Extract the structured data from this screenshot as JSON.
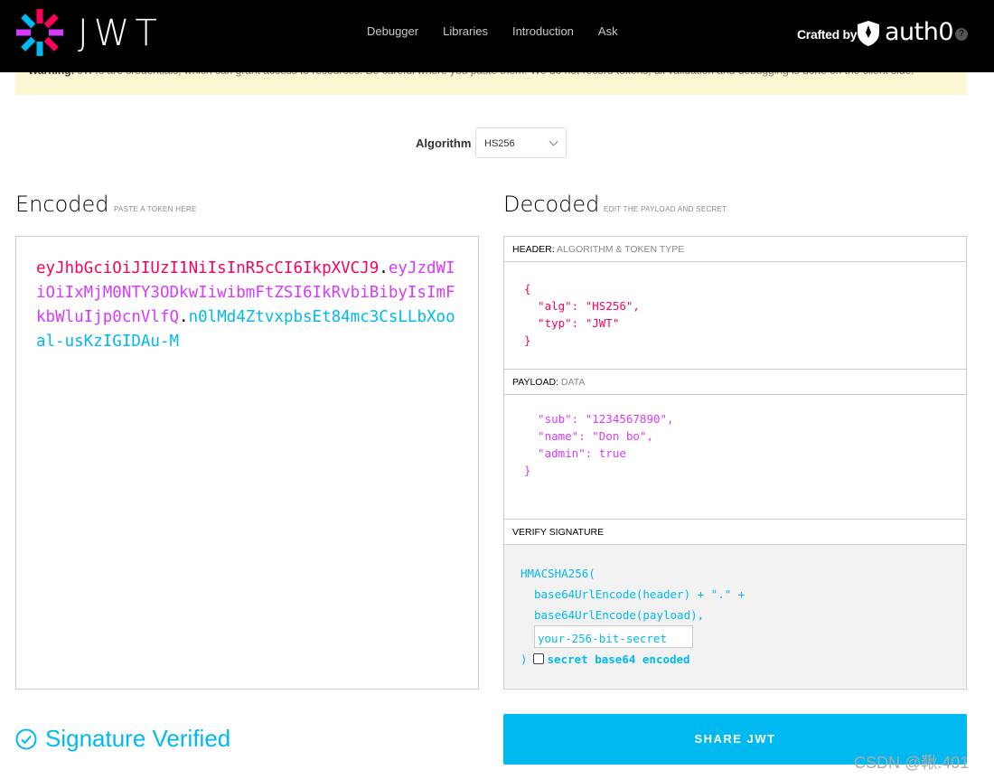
{
  "header": {
    "logo_text": "JWT",
    "nav": [
      "Debugger",
      "Libraries",
      "Introduction",
      "Ask"
    ],
    "crafted_by": "Crafted by",
    "brand": "auth0",
    "help": "?"
  },
  "warning": {
    "strong": "Warning:",
    "text": " JWTs are credentials, which can grant access to resources. Be careful where you paste them! We do not record tokens, all validation and debugging is done on the client side."
  },
  "algorithm": {
    "label": "Algorithm",
    "value": "HS256"
  },
  "encoded": {
    "title": "Encoded",
    "subtitle": "PASTE A TOKEN HERE",
    "header_part": "eyJhbGciOiJIUzI1NiIsInR5cCI6IkpXVCJ9",
    "payload_part": "eyJzdWIiOiIxMjM0NTY3ODkwIiwibmFtZSI6IkRvbiBibyIsImFkbWluIjp0cnVlfQ",
    "signature_part": "n0lMd4ZtvxpbsEt84mc3CsLLbXooal-usKzIGIDAu-M",
    "dot": "."
  },
  "decoded": {
    "title": "Decoded",
    "subtitle": "EDIT THE PAYLOAD AND SECRET",
    "header_panel": {
      "label": "HEADER:",
      "sub": "ALGORITHM & TOKEN TYPE"
    },
    "header_lines": [
      "{",
      "  \"alg\": \"HS256\",",
      "  \"typ\": \"JWT\"",
      "}"
    ],
    "payload_panel": {
      "label": "PAYLOAD:",
      "sub": "DATA"
    },
    "payload_lines": [
      "  \"sub\": \"1234567890\",",
      "  \"name\": \"Don bo\",",
      "  \"admin\": true",
      "}"
    ],
    "verify_panel": {
      "label": "VERIFY SIGNATURE"
    },
    "verify": {
      "fn": "HMACSHA256(",
      "line1": "base64UrlEncode(header) + \".\" +",
      "line2": "base64UrlEncode(payload),",
      "secret_placeholder": "your-256-bit-secret",
      "close": ")",
      "checkbox_label": "secret base64 encoded"
    }
  },
  "footer": {
    "verified": "Signature Verified",
    "share": "SHARE JWT",
    "watermark": "CSDN @鞦.401"
  },
  "colors": {
    "header": "#fb015b",
    "payload": "#d63aff",
    "signature": "#00b9f1"
  }
}
